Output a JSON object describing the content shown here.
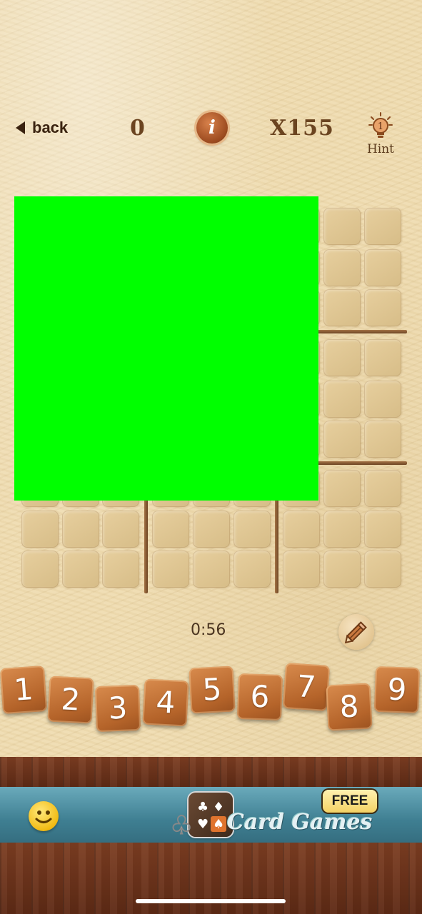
{
  "header": {
    "back_label": "back",
    "score": "0",
    "info_glyph": "i",
    "multiplier": "X155",
    "hint_label": "Hint",
    "hint_count": "1"
  },
  "board": {
    "placeholder_color": "#00ff00"
  },
  "timer": "0:56",
  "number_pad": [
    "1",
    "2",
    "3",
    "4",
    "5",
    "6",
    "7",
    "8",
    "9"
  ],
  "ad": {
    "title": "Card Games",
    "badge": "FREE"
  },
  "colors": {
    "text_brown": "#6b4420",
    "tile_orange": "#c2733a",
    "background": "#efdcb0",
    "wood": "#6a321a",
    "ad_blue": "#4a8ba0"
  }
}
